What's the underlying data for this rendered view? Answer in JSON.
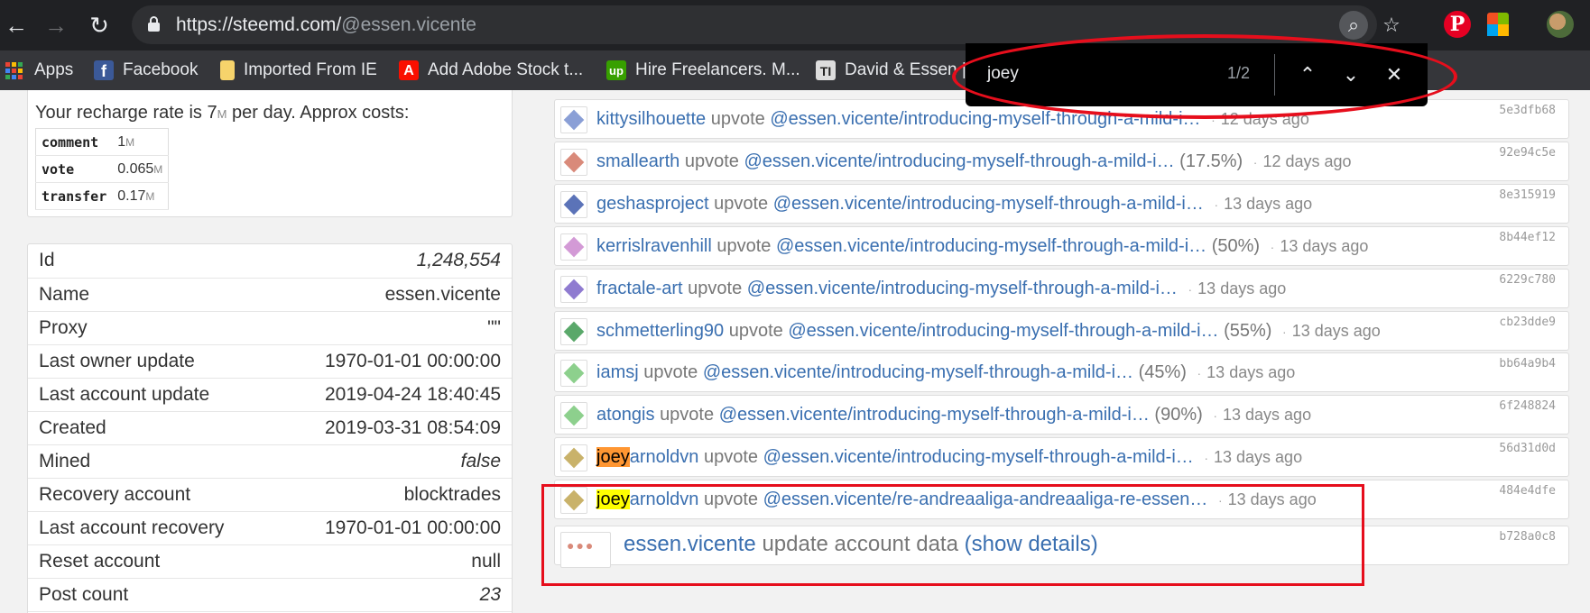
{
  "browser": {
    "url_host": "https://steemd.com/",
    "url_path": "@essen.vicente",
    "find": {
      "query": "joey",
      "count": "1/2"
    }
  },
  "bookmarks": [
    {
      "label": "Apps",
      "icon": "apps-icon"
    },
    {
      "label": "Facebook",
      "icon": "facebook-icon"
    },
    {
      "label": "Imported From IE",
      "icon": "folder-icon"
    },
    {
      "label": "Add Adobe Stock t...",
      "icon": "adobe-icon"
    },
    {
      "label": "Hire Freelancers. M...",
      "icon": "upwork-icon"
    },
    {
      "label": "David & Essen |",
      "icon": "bookmark-logo-icon"
    }
  ],
  "recharge": {
    "text_before": "Your recharge rate is 7",
    "text_unit": "M",
    "text_after": " per day. Approx costs:",
    "costs": [
      {
        "key": "comment",
        "value": "1",
        "unit": "M"
      },
      {
        "key": "vote",
        "value": "0.065",
        "unit": "M"
      },
      {
        "key": "transfer",
        "value": "0.17",
        "unit": "M"
      }
    ]
  },
  "properties": [
    {
      "label": "Id",
      "value": "1,248,554",
      "italic": true
    },
    {
      "label": "Name",
      "value": "essen.vicente",
      "italic": false
    },
    {
      "label": "Proxy",
      "value": "\"\"",
      "italic": false
    },
    {
      "label": "Last owner update",
      "value": "1970-01-01 00:00:00",
      "italic": false
    },
    {
      "label": "Last account update",
      "value": "2019-04-24 18:40:45",
      "italic": false
    },
    {
      "label": "Created",
      "value": "2019-03-31 08:54:09",
      "italic": false
    },
    {
      "label": "Mined",
      "value": "false",
      "italic": true
    },
    {
      "label": "Recovery account",
      "value": "blocktrades",
      "italic": false
    },
    {
      "label": "Last account recovery",
      "value": "1970-01-01 00:00:00",
      "italic": false
    },
    {
      "label": "Reset account",
      "value": "null",
      "italic": false
    },
    {
      "label": "Post count",
      "value": "23",
      "italic": true
    }
  ],
  "operations": [
    {
      "user_hl": "",
      "user": "kittysilhouette",
      "action": "upvote",
      "link": "@essen.vicente/introducing-myself-through-a-mild-i…",
      "pct": "",
      "ago": "12 days ago",
      "hash": "5e3dfb68",
      "avatar_color": "#8a9fd6"
    },
    {
      "user_hl": "",
      "user": "smallearth",
      "action": "upvote",
      "link": "@essen.vicente/introducing-myself-through-a-mild-i…",
      "pct": "(17.5%)",
      "ago": "12 days ago",
      "hash": "92e94c5e",
      "avatar_color": "#d98a7a"
    },
    {
      "user_hl": "",
      "user": "geshasproject",
      "action": "upvote",
      "link": "@essen.vicente/introducing-myself-through-a-mild-i…",
      "pct": "",
      "ago": "13 days ago",
      "hash": "8e315919",
      "avatar_color": "#5b73b8"
    },
    {
      "user_hl": "",
      "user": "kerrislravenhill",
      "action": "upvote",
      "link": "@essen.vicente/introducing-myself-through-a-mild-i…",
      "pct": "(50%)",
      "ago": "13 days ago",
      "hash": "8b44ef12",
      "avatar_color": "#d39ad6"
    },
    {
      "user_hl": "",
      "user": "fractale-art",
      "action": "upvote",
      "link": "@essen.vicente/introducing-myself-through-a-mild-i…",
      "pct": "",
      "ago": "13 days ago",
      "hash": "6229c780",
      "avatar_color": "#8f7bd0"
    },
    {
      "user_hl": "",
      "user": "schmetterling90",
      "action": "upvote",
      "link": "@essen.vicente/introducing-myself-through-a-mild-i…",
      "pct": "(55%)",
      "ago": "13 days ago",
      "hash": "cb23dde9",
      "avatar_color": "#5aa86a"
    },
    {
      "user_hl": "",
      "user": "iamsj",
      "action": "upvote",
      "link": "@essen.vicente/introducing-myself-through-a-mild-i…",
      "pct": "(45%)",
      "ago": "13 days ago",
      "hash": "bb64a9b4",
      "avatar_color": "#8dd08d"
    },
    {
      "user_hl": "",
      "user": "atongis",
      "action": "upvote",
      "link": "@essen.vicente/introducing-myself-through-a-mild-i…",
      "pct": "(90%)",
      "ago": "13 days ago",
      "hash": "6f248824",
      "avatar_color": "#8dd08d"
    },
    {
      "user_hl": "joey",
      "user": "arnoldvn",
      "action": "upvote",
      "link": "@essen.vicente/introducing-myself-through-a-mild-i…",
      "pct": "",
      "ago": "13 days ago",
      "hash": "56d31d0d",
      "avatar_color": "#c9b26a",
      "hl": "orange"
    },
    {
      "user_hl": "joey",
      "user": "arnoldvn",
      "action": "upvote",
      "link": "@essen.vicente/re-andreaaliga-andreaaliga-re-essen…",
      "pct": "",
      "ago": "13 days ago",
      "hash": "484e4dfe",
      "avatar_color": "#c9b26a",
      "hl": "yellow"
    }
  ],
  "last_op": {
    "user": "essen.vicente",
    "action": "update account data",
    "link": "(show details)",
    "hash": "b728a0c8"
  }
}
